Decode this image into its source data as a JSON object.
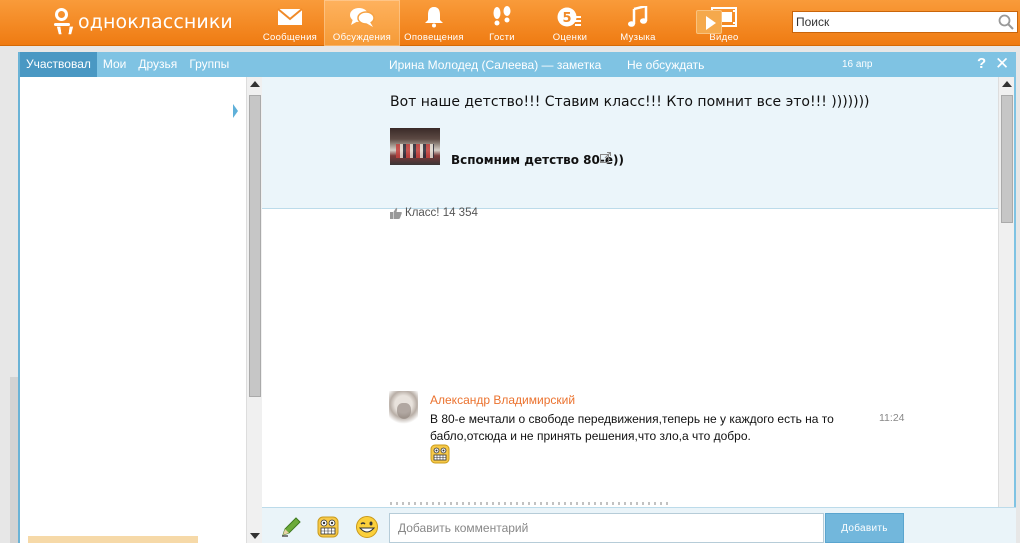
{
  "app": {
    "logo_text": "одноклассники"
  },
  "nav": [
    {
      "label": "Сообщения",
      "icon": "envelope-icon"
    },
    {
      "label": "Обсуждения",
      "icon": "chat-bubbles-icon"
    },
    {
      "label": "Оповещения",
      "icon": "bell-icon"
    },
    {
      "label": "Гости",
      "icon": "footprints-icon"
    },
    {
      "label": "Оценки",
      "icon": "ratings-icon"
    },
    {
      "label": "Музыка",
      "icon": "music-note-icon"
    },
    {
      "label": "Видео",
      "icon": "video-icon"
    }
  ],
  "search": {
    "placeholder": "Поиск"
  },
  "left_panel": {
    "tabs": [
      "Участвовал",
      "Мои",
      "Друзья",
      "Группы"
    ],
    "active_tab": "Участвовал"
  },
  "discussion": {
    "title": "Ирина Молодед (Салеева) — заметка",
    "no_discuss": "Не обсуждать",
    "date": "16 апр",
    "help": "?",
    "close": "✕",
    "post_text": "Вот наше детство!!! Ставим класс!!! Кто помнит все это!!! )))))))",
    "link_title": "Вспомним детство 80-е))",
    "likes": "Класс! 14 354"
  },
  "comment": {
    "author": "Александр Владимирский",
    "text": "В 80-е мечтали о свободе передвижения,теперь не у каждого есть на то бабло,отсюда и не принять решения,что зло,а что добро.",
    "time": "11:24"
  },
  "composer": {
    "placeholder": "Добавить комментарий",
    "add_label": "Добавить"
  },
  "colors": {
    "topbar": "#f58a22",
    "panel_header": "#7fc3e3",
    "active_tab": "#4a98c3",
    "author": "#eb722e"
  }
}
